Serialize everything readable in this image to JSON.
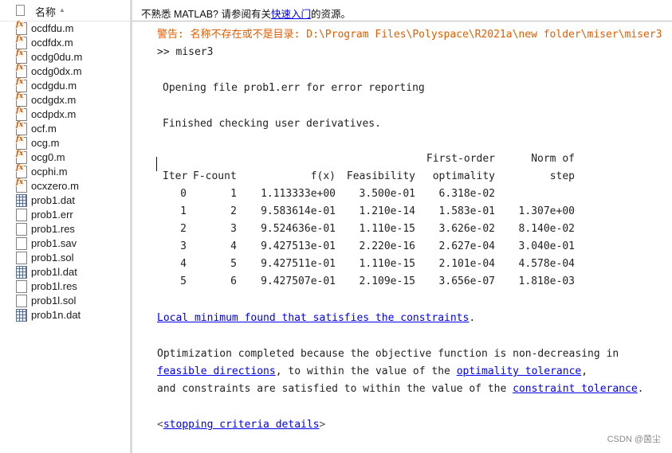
{
  "browser": {
    "header_label": "名称",
    "files": [
      {
        "name": "ocdfdu.m",
        "type": "m"
      },
      {
        "name": "ocdfdx.m",
        "type": "m"
      },
      {
        "name": "ocdg0du.m",
        "type": "m"
      },
      {
        "name": "ocdg0dx.m",
        "type": "m"
      },
      {
        "name": "ocdgdu.m",
        "type": "m"
      },
      {
        "name": "ocdgdx.m",
        "type": "m"
      },
      {
        "name": "ocdpdx.m",
        "type": "m"
      },
      {
        "name": "ocf.m",
        "type": "m"
      },
      {
        "name": "ocg.m",
        "type": "m"
      },
      {
        "name": "ocg0.m",
        "type": "m"
      },
      {
        "name": "ocphi.m",
        "type": "m"
      },
      {
        "name": "ocxzero.m",
        "type": "m"
      },
      {
        "name": "prob1.dat",
        "type": "dat"
      },
      {
        "name": "prob1.err",
        "type": "generic"
      },
      {
        "name": "prob1.res",
        "type": "generic"
      },
      {
        "name": "prob1.sav",
        "type": "generic"
      },
      {
        "name": "prob1.sol",
        "type": "generic"
      },
      {
        "name": "prob1l.dat",
        "type": "dat"
      },
      {
        "name": "prob1l.res",
        "type": "generic"
      },
      {
        "name": "prob1l.sol",
        "type": "generic"
      },
      {
        "name": "prob1n.dat",
        "type": "dat"
      }
    ]
  },
  "info_bar": {
    "prefix": "不熟悉 MATLAB? 请参阅有关",
    "link": "快速入门",
    "suffix": "的资源。"
  },
  "output": {
    "warning": "警告: 名称不存在或不是目录: D:\\Program Files\\Polyspace\\R2021a\\new folder\\miser\\miser3",
    "prompt": ">> miser3",
    "opening": "Opening file prob1.err for error reporting",
    "finished": "Finished checking user derivatives.",
    "table": {
      "header_top": {
        "optimality": "First-order",
        "step": "Norm of"
      },
      "headers": {
        "iter": "Iter",
        "fcount": "F-count",
        "fx": "f(x)",
        "feas": "Feasibility",
        "opt": "optimality",
        "step": "step"
      },
      "rows": [
        {
          "iter": "0",
          "fcount": "1",
          "fx": "1.113333e+00",
          "feas": "3.500e-01",
          "opt": "6.318e-02",
          "step": ""
        },
        {
          "iter": "1",
          "fcount": "2",
          "fx": "9.583614e-01",
          "feas": "1.210e-14",
          "opt": "1.583e-01",
          "step": "1.307e+00"
        },
        {
          "iter": "2",
          "fcount": "3",
          "fx": "9.524636e-01",
          "feas": "1.110e-15",
          "opt": "3.626e-02",
          "step": "8.140e-02"
        },
        {
          "iter": "3",
          "fcount": "4",
          "fx": "9.427513e-01",
          "feas": "2.220e-16",
          "opt": "2.627e-04",
          "step": "3.040e-01"
        },
        {
          "iter": "4",
          "fcount": "5",
          "fx": "9.427511e-01",
          "feas": "1.110e-15",
          "opt": "2.101e-04",
          "step": "4.578e-04"
        },
        {
          "iter": "5",
          "fcount": "6",
          "fx": "9.427507e-01",
          "feas": "2.109e-15",
          "opt": "3.656e-07",
          "step": "1.818e-03"
        }
      ]
    },
    "local_min_link": "Local minimum found that satisfies the constraints",
    "local_min_period": ".",
    "completion": {
      "line1": "Optimization completed because the objective function is non-decreasing in",
      "link_feasible": "feasible directions",
      "line2_mid": ", to within the value of the ",
      "link_optimality": "optimality tolerance",
      "line2_end": ",",
      "line3_start": "and constraints are satisfied to within the value of the ",
      "link_constraint": "constraint tolerance",
      "line3_end": "."
    },
    "stopping_open": "<",
    "stopping_link": "stopping criteria details",
    "stopping_close": ">"
  },
  "watermark": "CSDN @茵尘"
}
